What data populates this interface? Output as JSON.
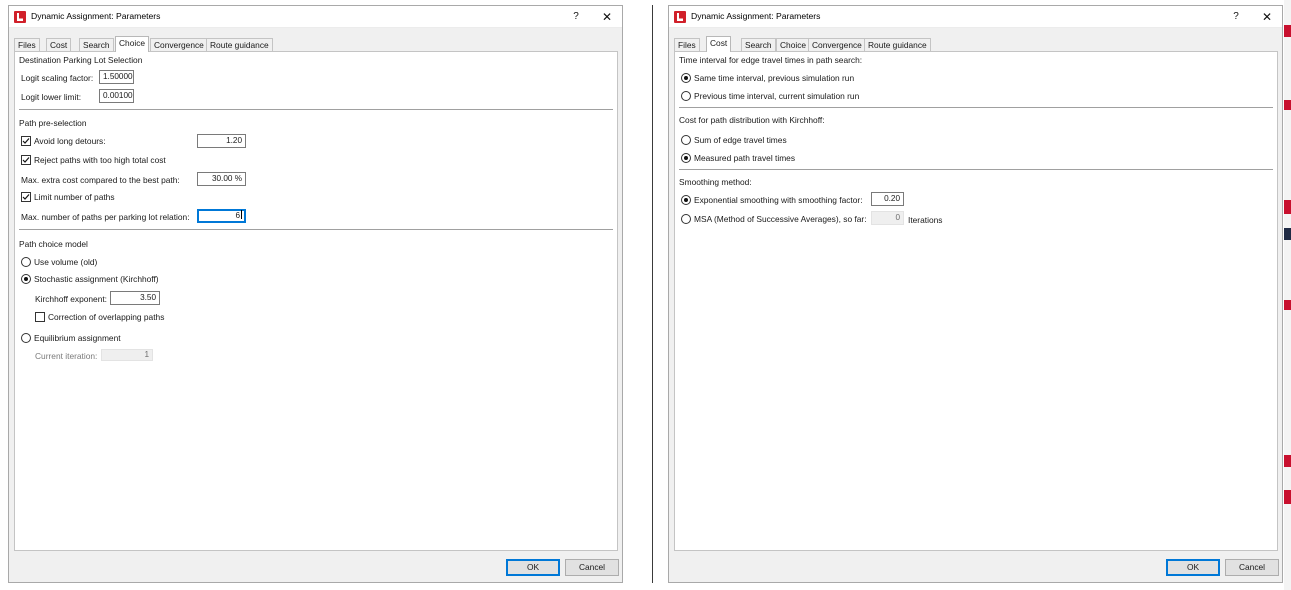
{
  "left_window": {
    "title": "Dynamic Assignment: Parameters",
    "help_glyph": "?",
    "close_glyph": "✕",
    "tabs": [
      "Files",
      "Cost",
      "Search",
      "Choice",
      "Convergence",
      "Route guidance"
    ],
    "active_tab": "Choice",
    "dest_parking": {
      "heading": "Destination Parking Lot Selection",
      "logit_scaling_label": "Logit scaling factor:",
      "logit_scaling_value": "1.50000",
      "logit_lower_label": "Logit lower limit:",
      "logit_lower_value": "0.00100"
    },
    "preselection": {
      "heading": "Path pre-selection",
      "avoid_detours_label": "Avoid long detours:",
      "avoid_detours_checked": true,
      "avoid_detours_value": "1.20",
      "reject_label": "Reject paths with too high total cost",
      "reject_checked": true,
      "max_extra_label": "Max. extra cost compared to the best path:",
      "max_extra_value": "30.00 %",
      "limit_label": "Limit number of paths",
      "limit_checked": true,
      "max_paths_label": "Max. number of paths per parking lot relation:",
      "max_paths_value": "6"
    },
    "choice_model": {
      "heading": "Path choice model",
      "use_volume_label": "Use volume (old)",
      "stochastic_label": "Stochastic assignment (Kirchhoff)",
      "selected": "stochastic",
      "kirchhoff_label": "Kirchhoff exponent:",
      "kirchhoff_value": "3.50",
      "correction_label": "Correction of overlapping paths",
      "correction_checked": false,
      "equilibrium_label": "Equilibrium assignment",
      "iteration_label": "Current iteration:",
      "iteration_value": "1"
    },
    "ok_label": "OK",
    "cancel_label": "Cancel"
  },
  "right_window": {
    "title": "Dynamic Assignment: Parameters",
    "help_glyph": "?",
    "close_glyph": "✕",
    "tabs": [
      "Files",
      "Cost",
      "Search",
      "Choice",
      "Convergence",
      "Route guidance"
    ],
    "active_tab": "Cost",
    "time_interval": {
      "heading": "Time interval for edge travel times in path search:",
      "option1": "Same time interval, previous simulation run",
      "option2": "Previous time interval, current simulation run",
      "selected": "option1"
    },
    "cost_kirchhoff": {
      "heading": "Cost for path distribution with Kirchhoff:",
      "option1": "Sum of edge travel times",
      "option2": "Measured path travel times",
      "selected": "option2"
    },
    "smoothing": {
      "heading": "Smoothing method:",
      "exponential_label": "Exponential smoothing with smoothing factor:",
      "exponential_value": "0.20",
      "msa_label": "MSA (Method of Successive Averages), so far:",
      "msa_value": "0",
      "msa_unit": "Iterations",
      "selected": "exponential"
    },
    "ok_label": "OK",
    "cancel_label": "Cancel"
  },
  "colors": {
    "app_icon_red": "#d1202a",
    "focus_blue": "#0078d7",
    "dialog_bg": "#f0f0f0",
    "panel_bg": "#ffffff",
    "edge_strip_red": "#c8102e",
    "edge_strip_navy": "#1f2a44"
  },
  "icons": {
    "app": "app-logo-icon",
    "help": "help-icon",
    "close": "close-icon",
    "check": "checkmark-icon"
  }
}
